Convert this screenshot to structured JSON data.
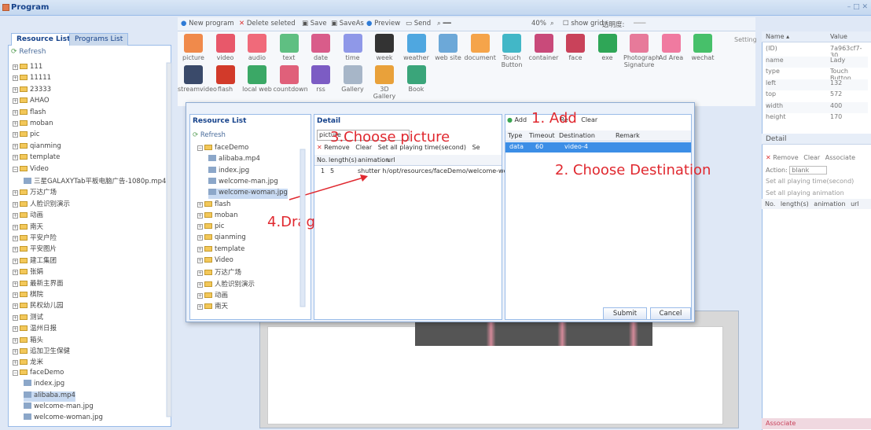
{
  "window": {
    "title": "Program",
    "controls": "– □ ✕"
  },
  "left": {
    "tabs": [
      "Resource List",
      "Programs List"
    ],
    "refresh": "Refresh",
    "tree": [
      {
        "label": "111",
        "type": "folder"
      },
      {
        "label": "11111",
        "type": "folder"
      },
      {
        "label": "23333",
        "type": "folder"
      },
      {
        "label": "AHAO",
        "type": "folder"
      },
      {
        "label": "flash",
        "type": "folder"
      },
      {
        "label": "moban",
        "type": "folder"
      },
      {
        "label": "pic",
        "type": "folder"
      },
      {
        "label": "qianming",
        "type": "folder"
      },
      {
        "label": "template",
        "type": "folder"
      },
      {
        "label": "Video",
        "type": "folder-open"
      },
      {
        "label": "三星GALAXYTab平板电脑广告-1080p.mp4",
        "type": "file",
        "indent": 1
      },
      {
        "label": "万达广场",
        "type": "folder"
      },
      {
        "label": "人脸识别演示",
        "type": "folder"
      },
      {
        "label": "动画",
        "type": "folder"
      },
      {
        "label": "南天",
        "type": "folder"
      },
      {
        "label": "平安户险",
        "type": "folder"
      },
      {
        "label": "平安图片",
        "type": "folder"
      },
      {
        "label": "建工集团",
        "type": "folder"
      },
      {
        "label": "张娟",
        "type": "folder"
      },
      {
        "label": "最新主界面",
        "type": "folder"
      },
      {
        "label": "棋院",
        "type": "folder"
      },
      {
        "label": "民权幼儿园",
        "type": "folder"
      },
      {
        "label": "测试",
        "type": "folder"
      },
      {
        "label": "温州日报",
        "type": "folder"
      },
      {
        "label": "箱头",
        "type": "folder"
      },
      {
        "label": "追加卫生保健",
        "type": "folder"
      },
      {
        "label": "龙米",
        "type": "folder"
      },
      {
        "label": "faceDemo",
        "type": "folder-open"
      },
      {
        "label": "index.jpg",
        "type": "file",
        "indent": 1
      },
      {
        "label": "alibaba.mp4",
        "type": "file",
        "indent": 1,
        "selected": true
      },
      {
        "label": "welcome-man.jpg",
        "type": "file",
        "indent": 1
      },
      {
        "label": "welcome-woman.jpg",
        "type": "file",
        "indent": 1
      }
    ]
  },
  "toolbar": [
    "New program",
    "Delete seleted",
    "Save",
    "SaveAs",
    "Preview",
    "Send",
    "40%",
    "show grid",
    "透明度:"
  ],
  "icons": [
    {
      "label": "picture",
      "color": "#f08a4b"
    },
    {
      "label": "video",
      "color": "#e8586a"
    },
    {
      "label": "audio",
      "color": "#f06a7a"
    },
    {
      "label": "text",
      "color": "#5fbf82"
    },
    {
      "label": "date",
      "color": "#d95c8a"
    },
    {
      "label": "time",
      "color": "#8f98e8"
    },
    {
      "label": "week",
      "color": "#333333"
    },
    {
      "label": "weather",
      "color": "#4fa7e0"
    },
    {
      "label": "web site",
      "color": "#6ca8d8"
    },
    {
      "label": "document",
      "color": "#f5a44a"
    },
    {
      "label": "Touch Button",
      "color": "#42b7c7"
    },
    {
      "label": "container",
      "color": "#c94a7a"
    },
    {
      "label": "face",
      "color": "#c9425a"
    },
    {
      "label": "exe",
      "color": "#2fa657"
    },
    {
      "label": "Photograph Signature",
      "color": "#e77a9a"
    },
    {
      "label": "Ad Area",
      "color": "#f07aa0"
    },
    {
      "label": "wechat",
      "color": "#47c06a"
    },
    {
      "label": "streamvideo",
      "color": "#3a4a6a"
    },
    {
      "label": "flash",
      "color": "#d23a2a"
    },
    {
      "label": "local web",
      "color": "#3ba866"
    },
    {
      "label": "countdown",
      "color": "#e0607a"
    },
    {
      "label": "rss",
      "color": "#7c5cc4"
    },
    {
      "label": "Gallery",
      "color": "#a7b6c8"
    },
    {
      "label": "3D Gallery",
      "color": "#e9a13a"
    },
    {
      "label": "Book",
      "color": "#3aa57a"
    }
  ],
  "setting": "Setting",
  "props": {
    "headers": [
      "Name ▴",
      "Value"
    ],
    "rows": [
      [
        "(ID)",
        "7a963cf7-30..."
      ],
      [
        "name",
        "Lady"
      ],
      [
        "type",
        "Touch Button"
      ],
      [
        "left",
        "132"
      ],
      [
        "top",
        "572"
      ],
      [
        "width",
        "400"
      ],
      [
        "height",
        "170"
      ]
    ]
  },
  "detail_right": {
    "title": "Detail",
    "remove": "Remove",
    "clear": "Clear",
    "associate": "Associate",
    "action_label": "Action:",
    "action_value": "blank",
    "set_time": "Set all playing time(second)",
    "set_anim": "Set all playing animation",
    "cols": [
      "No.",
      "length(s)",
      "animation",
      "url"
    ],
    "footer": "Associate"
  },
  "dialog": {
    "res_title": "Resource List",
    "refresh": "Refresh",
    "tree": [
      {
        "label": "faceDemo",
        "type": "folder-open"
      },
      {
        "label": "alibaba.mp4",
        "type": "file",
        "indent": 1
      },
      {
        "label": "index.jpg",
        "type": "file",
        "indent": 1
      },
      {
        "label": "welcome-man.jpg",
        "type": "file",
        "indent": 1
      },
      {
        "label": "welcome-woman.jpg",
        "type": "file",
        "indent": 1,
        "selected": true
      },
      {
        "label": "flash",
        "type": "folder"
      },
      {
        "label": "moban",
        "type": "folder"
      },
      {
        "label": "pic",
        "type": "folder"
      },
      {
        "label": "qianming",
        "type": "folder"
      },
      {
        "label": "template",
        "type": "folder"
      },
      {
        "label": "Video",
        "type": "folder"
      },
      {
        "label": "万达广场",
        "type": "folder"
      },
      {
        "label": "人脸识别演示",
        "type": "folder"
      },
      {
        "label": "动画",
        "type": "folder"
      },
      {
        "label": "南天",
        "type": "folder"
      }
    ],
    "detail_title": "Detail",
    "select_value": "picture",
    "remove": "Remove",
    "clear": "Clear",
    "set_time": "Set all playing time(second)",
    "se": "Se",
    "cols": [
      "No.",
      "length(s)",
      "animation",
      "url"
    ],
    "row": [
      "1",
      "5",
      "shutter h",
      "/opt/resources/faceDemo/welcome-wor"
    ],
    "add": "Add",
    "re": "Re",
    "clear2": "Clear",
    "dest_cols": [
      "Type",
      "Timeout",
      "Destination",
      "Remark"
    ],
    "dest_row": [
      "data",
      "60",
      "video-4",
      ""
    ],
    "submit": "Submit",
    "cancel": "Cancel"
  },
  "annotations": [
    "1. Add",
    "2. Choose Destination",
    "3.Choose picture",
    "4.Drag"
  ]
}
